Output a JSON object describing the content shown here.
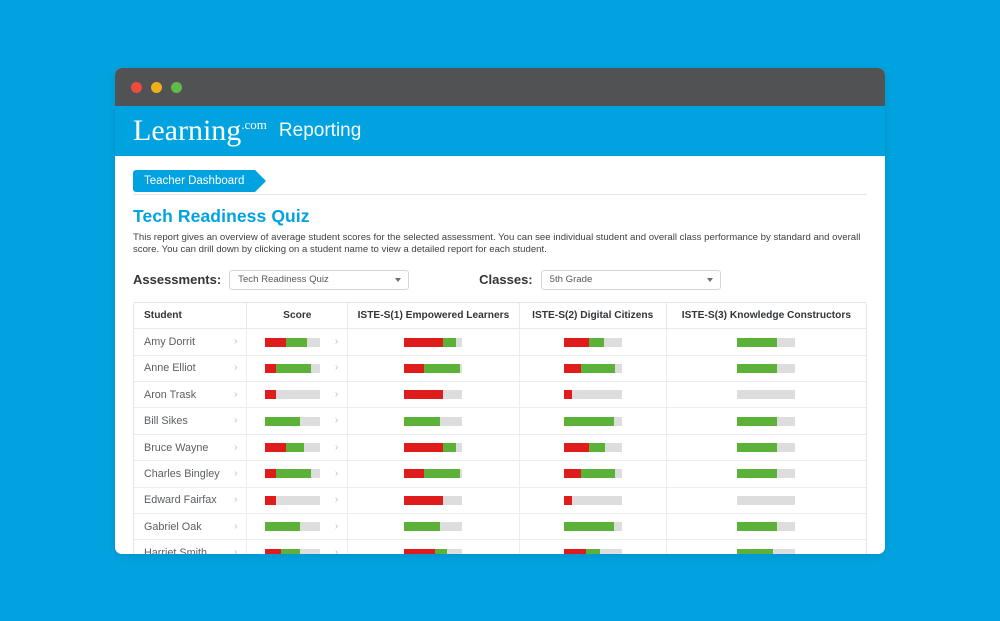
{
  "window": {
    "dots": [
      "close-dot",
      "minimize-dot",
      "maximize-dot"
    ]
  },
  "header": {
    "logo_main": "Learning",
    "logo_suffix": ".com",
    "app_name": "Reporting"
  },
  "breadcrumb": {
    "label": "Teacher Dashboard"
  },
  "page": {
    "title": "Tech Readiness Quiz",
    "description": "This report gives an overview of average student scores for the selected assessment. You can see individual student and overall class performance by standard and overall score. You can drill down by clicking on a student name to view a detailed report for each student."
  },
  "filters": {
    "assessments_label": "Assessments:",
    "assessments_value": "Tech Readiness Quiz",
    "classes_label": "Classes:",
    "classes_value": "5th Grade"
  },
  "table": {
    "columns": [
      "Student",
      "Score",
      "ISTE-S(1) Empowered Learners",
      "ISTE-S(2) Digital Citizens",
      "ISTE-S(3) Knowledge Constructors"
    ],
    "chevron": "›",
    "rows": [
      {
        "student": "Amy Dorrit",
        "score": {
          "red": 38,
          "green": 38
        },
        "iste1": {
          "red": 67,
          "green": 22
        },
        "iste2": {
          "red": 43,
          "green": 27
        },
        "iste3": {
          "red": 0,
          "green": 68
        }
      },
      {
        "student": "Anne Elliot",
        "score": {
          "red": 20,
          "green": 62
        },
        "iste1": {
          "red": 33,
          "green": 62
        },
        "iste2": {
          "red": 29,
          "green": 59
        },
        "iste3": {
          "red": 0,
          "green": 68
        }
      },
      {
        "student": "Aron Trask",
        "score": {
          "red": 19,
          "green": 0
        },
        "iste1": {
          "red": 67,
          "green": 0
        },
        "iste2": {
          "red": 14,
          "green": 0
        },
        "iste3": {
          "red": 0,
          "green": 0
        }
      },
      {
        "student": "Bill Sikes",
        "score": {
          "red": 0,
          "green": 62
        },
        "iste1": {
          "red": 0,
          "green": 62
        },
        "iste2": {
          "red": 0,
          "green": 86
        },
        "iste3": {
          "red": 0,
          "green": 68
        }
      },
      {
        "student": "Bruce Wayne",
        "score": {
          "red": 38,
          "green": 33
        },
        "iste1": {
          "red": 67,
          "green": 22
        },
        "iste2": {
          "red": 43,
          "green": 29
        },
        "iste3": {
          "red": 0,
          "green": 68
        }
      },
      {
        "student": "Charles Bingley",
        "score": {
          "red": 20,
          "green": 62
        },
        "iste1": {
          "red": 33,
          "green": 62
        },
        "iste2": {
          "red": 29,
          "green": 59
        },
        "iste3": {
          "red": 0,
          "green": 68
        }
      },
      {
        "student": "Edward Fairfax",
        "score": {
          "red": 19,
          "green": 0
        },
        "iste1": {
          "red": 67,
          "green": 0
        },
        "iste2": {
          "red": 14,
          "green": 0
        },
        "iste3": {
          "red": 0,
          "green": 0
        }
      },
      {
        "student": "Gabriel Oak",
        "score": {
          "red": 0,
          "green": 62
        },
        "iste1": {
          "red": 0,
          "green": 62
        },
        "iste2": {
          "red": 0,
          "green": 86
        },
        "iste3": {
          "red": 0,
          "green": 68
        }
      },
      {
        "student": "Harriet Smith",
        "score": {
          "red": 29,
          "green": 33
        },
        "iste1": {
          "red": 52,
          "green": 22
        },
        "iste2": {
          "red": 38,
          "green": 24
        },
        "iste3": {
          "red": 0,
          "green": 62
        }
      }
    ]
  },
  "colors": {
    "brand": "#00a3e0",
    "titlebar": "#515254",
    "bar_red": "#e01b1b",
    "bar_green": "#5cb239",
    "bar_track": "#dddddd"
  }
}
